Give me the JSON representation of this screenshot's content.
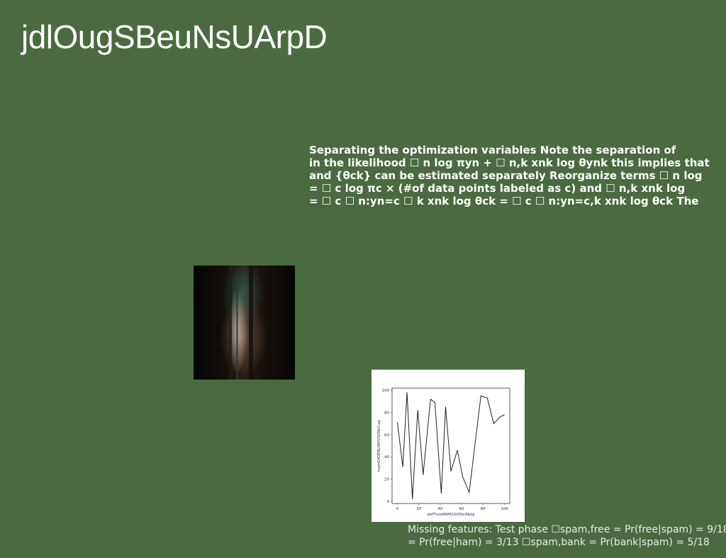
{
  "page": {
    "title": "jdlOugSBeuNsUArpD",
    "paragraph_lines": [
      "Separating the optimization variables Note the separation of",
      "in the likelihood ☐ n log πyn + ☐ n,k xnk log θynk this implies that",
      "and {θck} can be estimated separately Reorganize terms ☐ n log",
      "= ☐ c log πc × (#of data points labeled as c) and ☐ n,k xnk log",
      "= ☐ c ☐ n:yn=c ☐ k xnk log θck = ☐ c ☐ n:yn=c,k xnk log θck The"
    ],
    "caption_lines": [
      "Missing features: Test phase ☐spam,free = Pr(free|spam) = 9/18",
      "= Pr(free|ham) = 3/13 ☐spam,bank = Pr(bank|spam) = 5/18"
    ]
  },
  "chart_data": {
    "type": "line",
    "title": "",
    "xlabel": "ebfTvzdAWfGSVIDvAbzg",
    "ylabel": "ksjmOfOERLtRVVSONzCap",
    "xlim": [
      -5,
      105
    ],
    "ylim": [
      -2,
      102
    ],
    "xticks": [
      0,
      20,
      40,
      60,
      80,
      100
    ],
    "yticks": [
      0,
      20,
      40,
      60,
      80,
      100
    ],
    "grid": false,
    "series": [
      {
        "x": [
          0,
          5,
          9,
          14,
          19,
          24,
          31,
          35,
          41,
          45,
          50,
          56,
          61,
          67,
          78,
          84,
          90,
          96,
          100
        ],
        "y": [
          71,
          31,
          98,
          2,
          82,
          24,
          92,
          89,
          7,
          85,
          27,
          46,
          22,
          8,
          95,
          93,
          70,
          76,
          78
        ],
        "color": "#222222"
      }
    ]
  }
}
